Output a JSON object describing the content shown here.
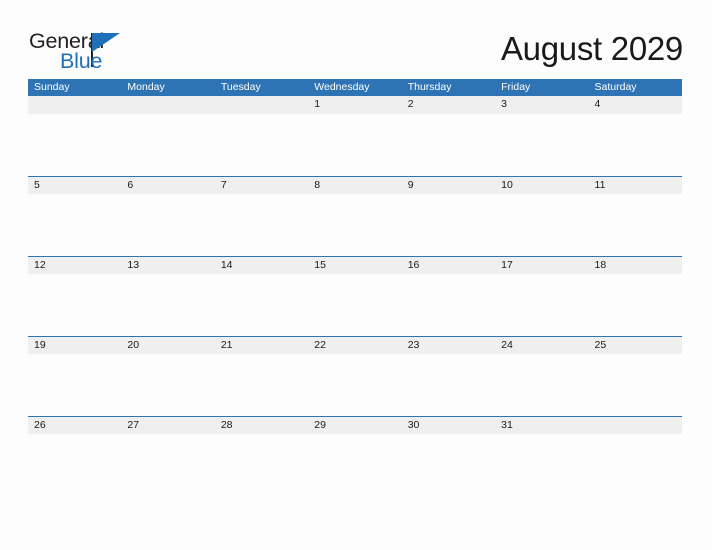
{
  "brand": {
    "name_part1": "General",
    "name_part2": "Blue",
    "accent_color": "#1F70B8",
    "text_color": "#231F20",
    "triangle_icon": "triangle-flag-icon"
  },
  "header": {
    "title": "August 2029",
    "month": "August",
    "year": "2029"
  },
  "theme": {
    "header_row_bg": "#2E74B5",
    "header_row_text": "#FFFFFF",
    "date_band_bg": "#EFEFEF",
    "row_divider": "#2E74B5",
    "page_bg": "#FDFDFD",
    "date_text": "#1A1A1A"
  },
  "calendar": {
    "weekdays": [
      "Sunday",
      "Monday",
      "Tuesday",
      "Wednesday",
      "Thursday",
      "Friday",
      "Saturday"
    ],
    "weeks": [
      {
        "days": [
          "",
          "",
          "",
          "1",
          "2",
          "3",
          "4"
        ]
      },
      {
        "days": [
          "5",
          "6",
          "7",
          "8",
          "9",
          "10",
          "11"
        ]
      },
      {
        "days": [
          "12",
          "13",
          "14",
          "15",
          "16",
          "17",
          "18"
        ]
      },
      {
        "days": [
          "19",
          "20",
          "21",
          "22",
          "23",
          "24",
          "25"
        ]
      },
      {
        "days": [
          "26",
          "27",
          "28",
          "29",
          "30",
          "31",
          ""
        ]
      }
    ]
  }
}
